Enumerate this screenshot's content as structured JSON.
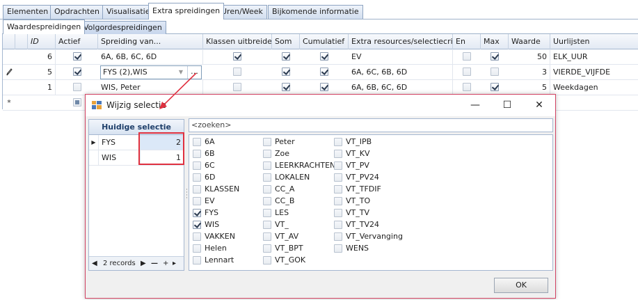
{
  "main_tabs": [
    "Elementen",
    "Opdrachten",
    "Visualisatie",
    "Extra spreidingen",
    "Uren/Week",
    "Bijkomende informatie"
  ],
  "main_tab_active": "Extra spreidingen",
  "sub_tabs": [
    "Waardespreidingen",
    "Volgordespreidingen"
  ],
  "sub_tab_active": "Waardespreidingen",
  "grid": {
    "headers": {
      "id": "ID",
      "actief": "Actief",
      "spreiding": "Spreiding van...",
      "klassen": "Klassen uitbreiden",
      "som": "Som",
      "cumulatief": "Cumulatief",
      "extra": "Extra resources/selectiecrit...",
      "en": "En",
      "max": "Max",
      "waarde": "Waarde",
      "uurlijsten": "Uurlijsten"
    },
    "rows": [
      {
        "indicator": "",
        "id": "6",
        "actief": true,
        "spreiding": "6A, 6B, 6C, 6D",
        "klassen": true,
        "som": true,
        "cumulatief": true,
        "extra": "EV",
        "en": false,
        "max": true,
        "waarde": "50",
        "uurlijsten": "ELK_UUR"
      },
      {
        "indicator": "pencil",
        "id": "5",
        "actief": true,
        "spreiding": "FYS (2),WIS",
        "klassen": false,
        "som": true,
        "cumulatief": true,
        "extra": "6A, 6C, 6B, 6D",
        "en": false,
        "max": false,
        "waarde": "3",
        "uurlijsten": "VIERDE_VIJFDE"
      },
      {
        "indicator": "",
        "id": "1",
        "actief": false,
        "spreiding": "WIS, Peter",
        "klassen": false,
        "som": true,
        "cumulatief": true,
        "extra": "6A, 6B, 6C, 6D",
        "en": false,
        "max": true,
        "waarde": "5",
        "uurlijsten": "Weekdagen"
      }
    ],
    "new_row_indicator": "*"
  },
  "dialog": {
    "title": "Wijzig selectie",
    "window_buttons": {
      "minimize": "—",
      "maximize": "☐",
      "close": "✕"
    },
    "current_selection": {
      "header": "Huidige selectie",
      "rows": [
        {
          "name": "FYS",
          "count": "2"
        },
        {
          "name": "WIS",
          "count": "1"
        }
      ],
      "records_label": "2 records"
    },
    "search_placeholder": "<zoeken>",
    "options": [
      {
        "label": "6A",
        "checked": false
      },
      {
        "label": "6B",
        "checked": false
      },
      {
        "label": "6C",
        "checked": false
      },
      {
        "label": "6D",
        "checked": false
      },
      {
        "label": "KLASSEN",
        "checked": false
      },
      {
        "label": "EV",
        "checked": false
      },
      {
        "label": "FYS",
        "checked": true
      },
      {
        "label": "WIS",
        "checked": true
      },
      {
        "label": "VAKKEN",
        "checked": false
      },
      {
        "label": "Helen",
        "checked": false
      },
      {
        "label": "Lennart",
        "checked": false
      },
      {
        "label": "Peter",
        "checked": false
      },
      {
        "label": "Zoe",
        "checked": false
      },
      {
        "label": "LEERKRACHTEN",
        "checked": false
      },
      {
        "label": "LOKALEN",
        "checked": false
      },
      {
        "label": "CC_A",
        "checked": false
      },
      {
        "label": "CC_B",
        "checked": false
      },
      {
        "label": "LES",
        "checked": false
      },
      {
        "label": "VT_",
        "checked": false
      },
      {
        "label": "VT_AV",
        "checked": false
      },
      {
        "label": "VT_BPT",
        "checked": false
      },
      {
        "label": "VT_GOK",
        "checked": false
      },
      {
        "label": "VT_IPB",
        "checked": false
      },
      {
        "label": "VT_KV",
        "checked": false
      },
      {
        "label": "VT_PV",
        "checked": false
      },
      {
        "label": "VT_PV24",
        "checked": false
      },
      {
        "label": "VT_TFDIF",
        "checked": false
      },
      {
        "label": "VT_TO",
        "checked": false
      },
      {
        "label": "VT_TV",
        "checked": false
      },
      {
        "label": "VT_TV24",
        "checked": false
      },
      {
        "label": "VT_Vervanging",
        "checked": false
      },
      {
        "label": "WENS",
        "checked": false
      }
    ],
    "ok_label": "OK"
  },
  "colors": {
    "accent_red": "#e0303f",
    "dialog_border": "#d24262",
    "header_blue": "#1f3f6a"
  }
}
